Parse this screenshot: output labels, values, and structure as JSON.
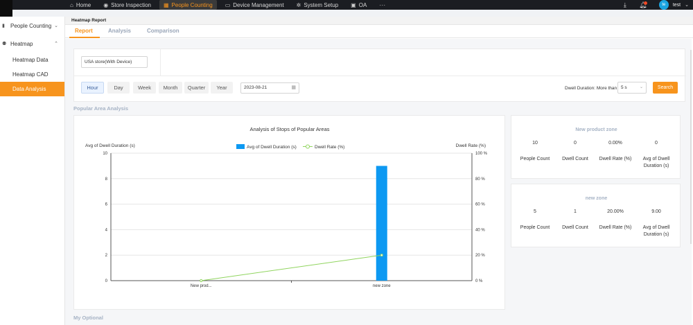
{
  "topnav": {
    "items": [
      {
        "label": "Home",
        "icon": "home-icon"
      },
      {
        "label": "Store Inspection",
        "icon": "camera-icon"
      },
      {
        "label": "People Counting",
        "icon": "people-counting-icon"
      },
      {
        "label": "Device Management",
        "icon": "device-icon"
      },
      {
        "label": "System Setup",
        "icon": "gear-icon"
      },
      {
        "label": "OA",
        "icon": "oa-icon"
      }
    ],
    "more": "···",
    "active": "People Counting",
    "avatar_text": "te",
    "username": "test"
  },
  "sidebar": {
    "people_counting": "People Counting",
    "heatmap": "Heatmap",
    "items": [
      {
        "label": "Heatmap Data"
      },
      {
        "label": "Heatmap CAD"
      },
      {
        "label": "Data Analysis"
      }
    ],
    "active": "Data Analysis"
  },
  "page": {
    "title": "Heatmap Report",
    "tabs": [
      {
        "label": "Report"
      },
      {
        "label": "Analysis"
      },
      {
        "label": "Comparison"
      }
    ],
    "active_tab": "Report"
  },
  "filters": {
    "store": "USA store(With Device)",
    "periods": [
      "Hour",
      "Day",
      "Week",
      "Month",
      "Quarter",
      "Year"
    ],
    "active_period": "Hour",
    "date": "2023-08-21",
    "dwell_label": "Dwell Duration: More than",
    "dwell_value": "5 s",
    "search_label": "Search"
  },
  "sections": {
    "popular": "Popular Area Analysis",
    "optional": "My Optional"
  },
  "chart_data": {
    "type": "bar",
    "title": "Analysis of Stops of Popular Areas",
    "categories": [
      "New prod...",
      "new zone"
    ],
    "series": [
      {
        "name": "Avg of Dwell Duration (s)",
        "type": "bar",
        "axis": "left",
        "values": [
          0,
          9
        ],
        "color": "#0d99f2"
      },
      {
        "name": "Dwell Rate (%)",
        "type": "line",
        "axis": "right",
        "values": [
          0,
          20
        ],
        "color": "#8fd45d"
      }
    ],
    "ylabel_left": "Avg of Dwell Duration (s)",
    "ylabel_right": "Dwell Rate (%)",
    "ylim_left": [
      0,
      10
    ],
    "ylim_right": [
      0,
      100
    ],
    "yticks_left": [
      "0",
      "2",
      "4",
      "6",
      "8",
      "10"
    ],
    "yticks_right": [
      "0 %",
      "20 %",
      "40 %",
      "60 %",
      "80 %",
      "100 %"
    ],
    "grid": true,
    "legend": "top-center"
  },
  "zones": [
    {
      "name": "New product zone",
      "values": [
        "10",
        "0",
        "0.00%",
        "0"
      ],
      "labels": [
        "People Count",
        "Dwell Count",
        "Dwell Rate (%)",
        "Avg of Dwell Duration (s)"
      ]
    },
    {
      "name": "new zone",
      "values": [
        "5",
        "1",
        "20.00%",
        "9.00"
      ],
      "labels": [
        "People Count",
        "Dwell Count",
        "Dwell Rate (%)",
        "Avg of Dwell Duration (s)"
      ]
    }
  ]
}
